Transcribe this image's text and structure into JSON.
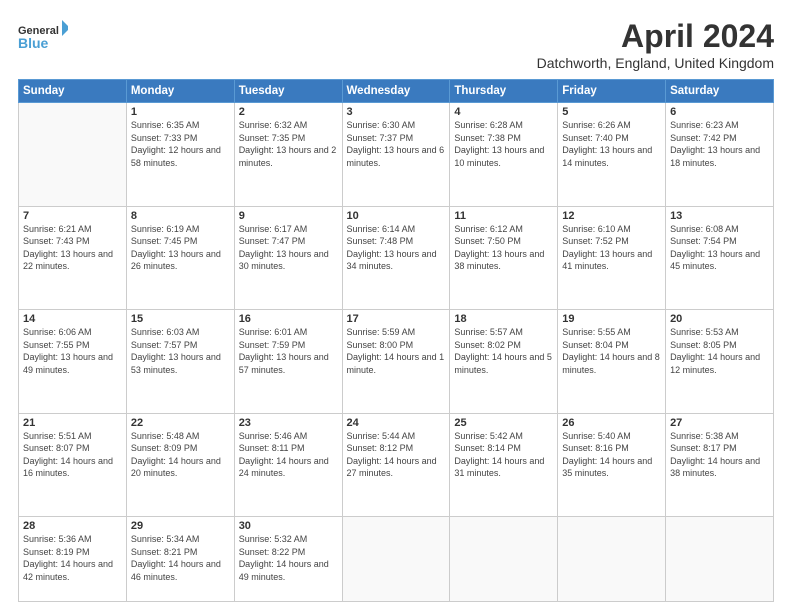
{
  "header": {
    "logo_line1": "General",
    "logo_line2": "Blue",
    "month": "April 2024",
    "location": "Datchworth, England, United Kingdom"
  },
  "weekdays": [
    "Sunday",
    "Monday",
    "Tuesday",
    "Wednesday",
    "Thursday",
    "Friday",
    "Saturday"
  ],
  "weeks": [
    [
      {
        "day": "",
        "info": ""
      },
      {
        "day": "1",
        "info": "Sunrise: 6:35 AM\nSunset: 7:33 PM\nDaylight: 12 hours\nand 58 minutes."
      },
      {
        "day": "2",
        "info": "Sunrise: 6:32 AM\nSunset: 7:35 PM\nDaylight: 13 hours\nand 2 minutes."
      },
      {
        "day": "3",
        "info": "Sunrise: 6:30 AM\nSunset: 7:37 PM\nDaylight: 13 hours\nand 6 minutes."
      },
      {
        "day": "4",
        "info": "Sunrise: 6:28 AM\nSunset: 7:38 PM\nDaylight: 13 hours\nand 10 minutes."
      },
      {
        "day": "5",
        "info": "Sunrise: 6:26 AM\nSunset: 7:40 PM\nDaylight: 13 hours\nand 14 minutes."
      },
      {
        "day": "6",
        "info": "Sunrise: 6:23 AM\nSunset: 7:42 PM\nDaylight: 13 hours\nand 18 minutes."
      }
    ],
    [
      {
        "day": "7",
        "info": "Sunrise: 6:21 AM\nSunset: 7:43 PM\nDaylight: 13 hours\nand 22 minutes."
      },
      {
        "day": "8",
        "info": "Sunrise: 6:19 AM\nSunset: 7:45 PM\nDaylight: 13 hours\nand 26 minutes."
      },
      {
        "day": "9",
        "info": "Sunrise: 6:17 AM\nSunset: 7:47 PM\nDaylight: 13 hours\nand 30 minutes."
      },
      {
        "day": "10",
        "info": "Sunrise: 6:14 AM\nSunset: 7:48 PM\nDaylight: 13 hours\nand 34 minutes."
      },
      {
        "day": "11",
        "info": "Sunrise: 6:12 AM\nSunset: 7:50 PM\nDaylight: 13 hours\nand 38 minutes."
      },
      {
        "day": "12",
        "info": "Sunrise: 6:10 AM\nSunset: 7:52 PM\nDaylight: 13 hours\nand 41 minutes."
      },
      {
        "day": "13",
        "info": "Sunrise: 6:08 AM\nSunset: 7:54 PM\nDaylight: 13 hours\nand 45 minutes."
      }
    ],
    [
      {
        "day": "14",
        "info": "Sunrise: 6:06 AM\nSunset: 7:55 PM\nDaylight: 13 hours\nand 49 minutes."
      },
      {
        "day": "15",
        "info": "Sunrise: 6:03 AM\nSunset: 7:57 PM\nDaylight: 13 hours\nand 53 minutes."
      },
      {
        "day": "16",
        "info": "Sunrise: 6:01 AM\nSunset: 7:59 PM\nDaylight: 13 hours\nand 57 minutes."
      },
      {
        "day": "17",
        "info": "Sunrise: 5:59 AM\nSunset: 8:00 PM\nDaylight: 14 hours\nand 1 minute."
      },
      {
        "day": "18",
        "info": "Sunrise: 5:57 AM\nSunset: 8:02 PM\nDaylight: 14 hours\nand 5 minutes."
      },
      {
        "day": "19",
        "info": "Sunrise: 5:55 AM\nSunset: 8:04 PM\nDaylight: 14 hours\nand 8 minutes."
      },
      {
        "day": "20",
        "info": "Sunrise: 5:53 AM\nSunset: 8:05 PM\nDaylight: 14 hours\nand 12 minutes."
      }
    ],
    [
      {
        "day": "21",
        "info": "Sunrise: 5:51 AM\nSunset: 8:07 PM\nDaylight: 14 hours\nand 16 minutes."
      },
      {
        "day": "22",
        "info": "Sunrise: 5:48 AM\nSunset: 8:09 PM\nDaylight: 14 hours\nand 20 minutes."
      },
      {
        "day": "23",
        "info": "Sunrise: 5:46 AM\nSunset: 8:11 PM\nDaylight: 14 hours\nand 24 minutes."
      },
      {
        "day": "24",
        "info": "Sunrise: 5:44 AM\nSunset: 8:12 PM\nDaylight: 14 hours\nand 27 minutes."
      },
      {
        "day": "25",
        "info": "Sunrise: 5:42 AM\nSunset: 8:14 PM\nDaylight: 14 hours\nand 31 minutes."
      },
      {
        "day": "26",
        "info": "Sunrise: 5:40 AM\nSunset: 8:16 PM\nDaylight: 14 hours\nand 35 minutes."
      },
      {
        "day": "27",
        "info": "Sunrise: 5:38 AM\nSunset: 8:17 PM\nDaylight: 14 hours\nand 38 minutes."
      }
    ],
    [
      {
        "day": "28",
        "info": "Sunrise: 5:36 AM\nSunset: 8:19 PM\nDaylight: 14 hours\nand 42 minutes."
      },
      {
        "day": "29",
        "info": "Sunrise: 5:34 AM\nSunset: 8:21 PM\nDaylight: 14 hours\nand 46 minutes."
      },
      {
        "day": "30",
        "info": "Sunrise: 5:32 AM\nSunset: 8:22 PM\nDaylight: 14 hours\nand 49 minutes."
      },
      {
        "day": "",
        "info": ""
      },
      {
        "day": "",
        "info": ""
      },
      {
        "day": "",
        "info": ""
      },
      {
        "day": "",
        "info": ""
      }
    ]
  ]
}
